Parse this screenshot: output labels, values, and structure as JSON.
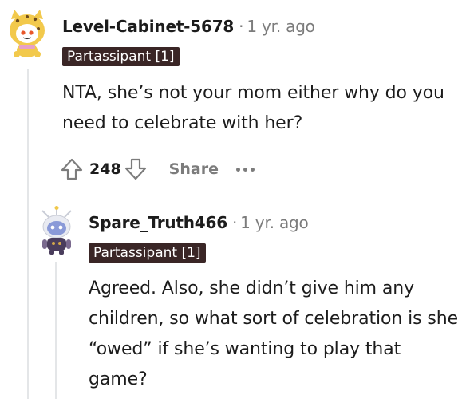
{
  "comments": [
    {
      "username": "Level-Cabinet-5678",
      "separator": "·",
      "time": "1 yr. ago",
      "flair": "Partassipant [1]",
      "body": "NTA, she’s not your mom either why do you need to celebrate with her?",
      "avatar_icon": "snoo-avatar-cat-costume-icon",
      "actions": {
        "upvote_icon": "upvote-arrow-icon",
        "score": "248",
        "downvote_icon": "downvote-arrow-icon",
        "share_label": "Share",
        "more_icon": "more-options-icon"
      }
    },
    {
      "username": "Spare_Truth466",
      "separator": "·",
      "time": "1 yr. ago",
      "flair": "Partassipant [1]",
      "body": "Agreed. Also, she didn’t give him any children, so what sort of celebration is she “owed” if she’s wanting to play that game?",
      "avatar_icon": "snoo-avatar-robot-icon"
    }
  ],
  "colors": {
    "flair_bg": "#3a2626",
    "meta_gray": "#7c7c7c",
    "thread_line": "#e4e6e8",
    "text": "#1c1c1c"
  }
}
